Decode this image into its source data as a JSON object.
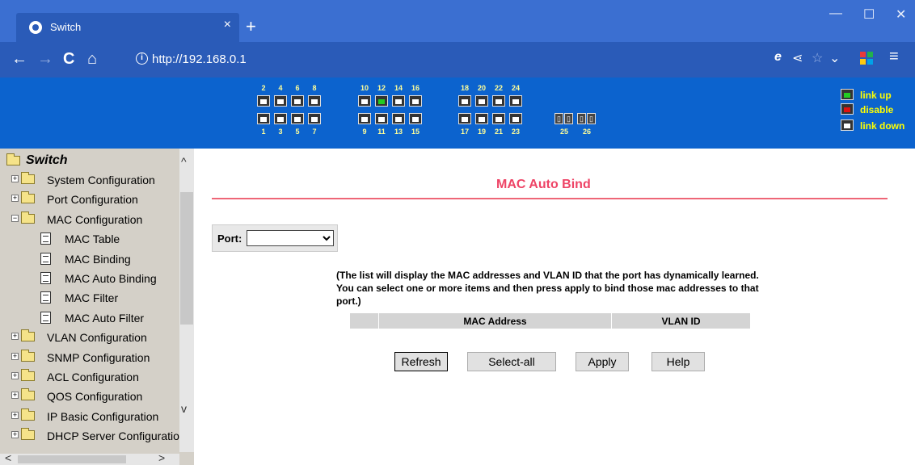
{
  "browser": {
    "tab_title": "Switch",
    "tab_close": "×",
    "new_tab": "+",
    "url": "http://192.168.0.1",
    "window_controls": {
      "minimize": "—",
      "maximize": "☐",
      "close": "✕"
    },
    "nav": {
      "back": "←",
      "forward": "→",
      "reload": "C",
      "home": "⌂"
    },
    "addr_icons": {
      "ie": "e",
      "share": "⋖",
      "favorite": "☆",
      "dropdown": "⌄",
      "menu": "≡"
    }
  },
  "banner": {
    "top_numbers": [
      "2",
      "4",
      "6",
      "8",
      "10",
      "12",
      "14",
      "16",
      "18",
      "20",
      "22",
      "24"
    ],
    "bottom_numbers": [
      "1",
      "3",
      "5",
      "7",
      "9",
      "11",
      "13",
      "15",
      "17",
      "19",
      "21",
      "23"
    ],
    "fiber_numbers": [
      "25",
      "26"
    ],
    "legend": {
      "link_up": "link up",
      "disable": "disable",
      "link_down": "link down"
    },
    "colors": {
      "link_up": "#22cc22",
      "disable": "#dd1111",
      "link_down": "#ffffff"
    }
  },
  "sidebar": {
    "root": "Switch",
    "items": [
      {
        "label": "System Configuration",
        "expander": "+"
      },
      {
        "label": "Port Configuration",
        "expander": "+"
      },
      {
        "label": "MAC Configuration",
        "expander": "−"
      },
      {
        "label": "MAC Table"
      },
      {
        "label": "MAC Binding"
      },
      {
        "label": "MAC Auto Binding"
      },
      {
        "label": "MAC Filter"
      },
      {
        "label": "MAC Auto Filter"
      },
      {
        "label": "VLAN Configuration",
        "expander": "+"
      },
      {
        "label": "SNMP Configuration",
        "expander": "+"
      },
      {
        "label": "ACL Configuration",
        "expander": "+"
      },
      {
        "label": "QOS Configuration",
        "expander": "+"
      },
      {
        "label": "IP Basic Configuration",
        "expander": "+"
      },
      {
        "label": "DHCP Server Configuratio",
        "expander": "+"
      }
    ],
    "scroll_up": "^",
    "scroll_down": "v",
    "scroll_left": "<",
    "scroll_right": ">"
  },
  "main": {
    "title": "MAC Auto Bind",
    "port_label": "Port:",
    "port_value": "",
    "note": "(The list will display the MAC addresses and VLAN ID that the port has dynamically learned. You can select one or more items and then press apply to bind those mac addresses to that port.)",
    "table_headers": [
      "",
      "MAC Address",
      "VLAN ID"
    ],
    "buttons": {
      "refresh": "Refresh",
      "select_all": "Select-all",
      "apply": "Apply",
      "help": "Help"
    }
  }
}
